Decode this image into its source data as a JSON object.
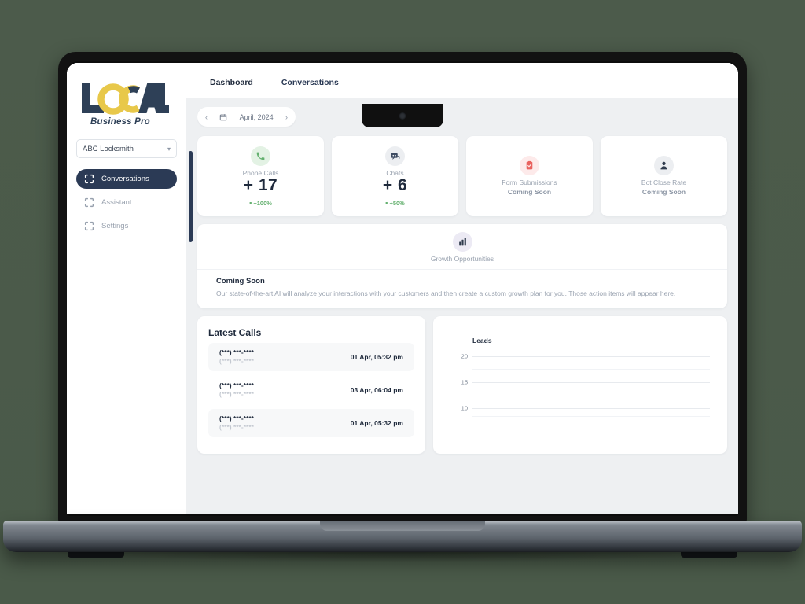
{
  "brand": {
    "logo_text": "LOCAL",
    "logo_sub": "Business Pro",
    "navy": "#2e4057",
    "yellow": "#e8c84a"
  },
  "sidebar": {
    "business_selector": {
      "value": "ABC Locksmith",
      "caret": "chevron-down-icon"
    },
    "items": [
      {
        "label": "Conversations",
        "icon": "grid-icon",
        "active": true
      },
      {
        "label": "Assistant",
        "icon": "grid-icon",
        "active": false
      },
      {
        "label": "Settings",
        "icon": "grid-icon",
        "active": false
      }
    ]
  },
  "tabs": [
    {
      "label": "Dashboard",
      "active": true
    },
    {
      "label": "Conversations",
      "active": false
    }
  ],
  "date_nav": {
    "prev": "‹",
    "next": "›",
    "calendar_icon": "calendar-icon",
    "label": "April, 2024"
  },
  "stats": [
    {
      "label": "Phone Calls",
      "value": "+ 17",
      "delta": "+100%",
      "delta_dot": "▪",
      "icon": "phone-icon",
      "icon_bg": "#e3f2e4",
      "icon_color": "#63b06e",
      "coming_soon": false
    },
    {
      "label": "Chats",
      "value": "+ 6",
      "delta": "+50%",
      "delta_dot": "▪",
      "icon": "chat-bot-icon",
      "icon_bg": "#eceef1",
      "icon_color": "#3c4a61",
      "coming_soon": false
    },
    {
      "label": "Form Submissions",
      "soon": "Coming Soon",
      "icon": "clipboard-check-icon",
      "icon_bg": "#fdeaea",
      "icon_color": "#e9625f",
      "coming_soon": true
    },
    {
      "label": "Bot Close Rate",
      "soon": "Coming Soon",
      "icon": "person-icon",
      "icon_bg": "#eceef1",
      "icon_color": "#3c4a61",
      "coming_soon": true
    }
  ],
  "growth": {
    "header_label": "Growth Opportunities",
    "header_icon": "bar-chart-icon",
    "header_icon_bg": "#eceaf4",
    "title": "Coming Soon",
    "body": "Our state-of-the-art AI will analyze your interactions with your customers and then create a custom growth plan for you. Those action items will appear here."
  },
  "latest_calls": {
    "title": "Latest Calls",
    "rows": [
      {
        "number": "(***) ***-****",
        "number_secondary": "(***) ***-****",
        "time": "01 Apr, 05:32 pm"
      },
      {
        "number": "(***) ***-****",
        "number_secondary": "(***) ***-****",
        "time": "03 Apr, 06:04 pm"
      },
      {
        "number": "(***) ***-****",
        "number_secondary": "(***) ***-****",
        "time": "01 Apr, 05:32 pm"
      }
    ]
  },
  "chart_data": {
    "type": "line",
    "title": "Leads",
    "xlabel": "",
    "ylabel": "",
    "ylim": [
      7.5,
      21.25
    ],
    "yticks": [
      20,
      15,
      10
    ],
    "ytick_labels": [
      "20",
      "15",
      "10"
    ],
    "minor_gridlines": [
      17.5,
      12.5,
      8.5
    ],
    "grid": true,
    "legend": "none",
    "categories": [],
    "values": [],
    "note": "No data series plotted; only gridlines visible"
  }
}
